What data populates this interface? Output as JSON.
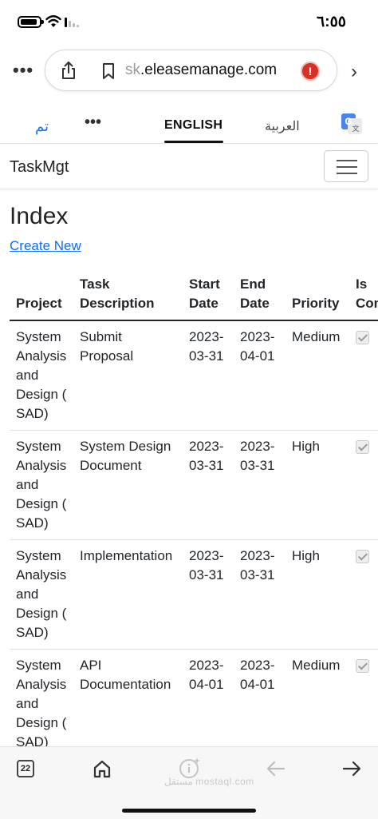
{
  "status_bar": {
    "time": "٦:٥٥"
  },
  "browser": {
    "url_faded": "sk",
    "url_text": ".eleasemanage.com"
  },
  "translate": {
    "done_label": "تم",
    "english_label": "ENGLISH",
    "arabic_label": "العربية"
  },
  "navbar": {
    "brand": "TaskMgt"
  },
  "page": {
    "title": "Index",
    "create_link": "Create New"
  },
  "table": {
    "headers": {
      "project": "Project",
      "task_line1": "Task",
      "task_line2": "Description",
      "start_line1": "Start",
      "start_line2": "Date",
      "end_line1": "End",
      "end_line2": "Date",
      "priority": "Priority",
      "is_line1": "Is",
      "is_line2": "Com"
    },
    "rows": [
      {
        "project_l1": "System",
        "project_l2": "Analysis",
        "project_l3": "and",
        "project_l4": "Design (",
        "project_l5": "SAD)",
        "task_l1": "Submit",
        "task_l2": "Proposal",
        "start_l1": "2023-",
        "start_l2": "03-31",
        "end_l1": "2023-",
        "end_l2": "04-01",
        "priority": "Medium",
        "completed": true
      },
      {
        "project_l1": "System",
        "project_l2": "Analysis",
        "project_l3": "and",
        "project_l4": "Design (",
        "project_l5": "SAD)",
        "task_l1": "System Design",
        "task_l2": "Document",
        "start_l1": "2023-",
        "start_l2": "03-31",
        "end_l1": "2023-",
        "end_l2": "03-31",
        "priority": "High",
        "completed": true
      },
      {
        "project_l1": "System",
        "project_l2": "Analysis",
        "project_l3": "and",
        "project_l4": "Design (",
        "project_l5": "SAD)",
        "task_l1": "Implementation",
        "task_l2": "",
        "start_l1": "2023-",
        "start_l2": "03-31",
        "end_l1": "2023-",
        "end_l2": "03-31",
        "priority": "High",
        "completed": true
      },
      {
        "project_l1": "System",
        "project_l2": "Analysis",
        "project_l3": "and",
        "project_l4": "Design (",
        "project_l5": "SAD)",
        "task_l1": "API",
        "task_l2": "Documentation",
        "start_l1": "2023-",
        "start_l2": "04-01",
        "end_l1": "2023-",
        "end_l2": "04-01",
        "priority": "Medium",
        "completed": true
      }
    ]
  },
  "bottom_bar": {
    "tab_count": "22",
    "watermark": "مستقل mostaql.com"
  },
  "colors": {
    "link": "#0d6efd",
    "translate_accent": "#1a73e8",
    "warning": "#d93025"
  },
  "icons": [
    "battery-icon",
    "wifi-icon",
    "signal-icon",
    "more-icon",
    "share-icon",
    "bookmark-icon",
    "warning-icon",
    "chevron-right-icon",
    "google-translate-icon",
    "hamburger-icon",
    "home-icon",
    "lens-icon",
    "back-arrow-icon",
    "forward-arrow-icon"
  ]
}
